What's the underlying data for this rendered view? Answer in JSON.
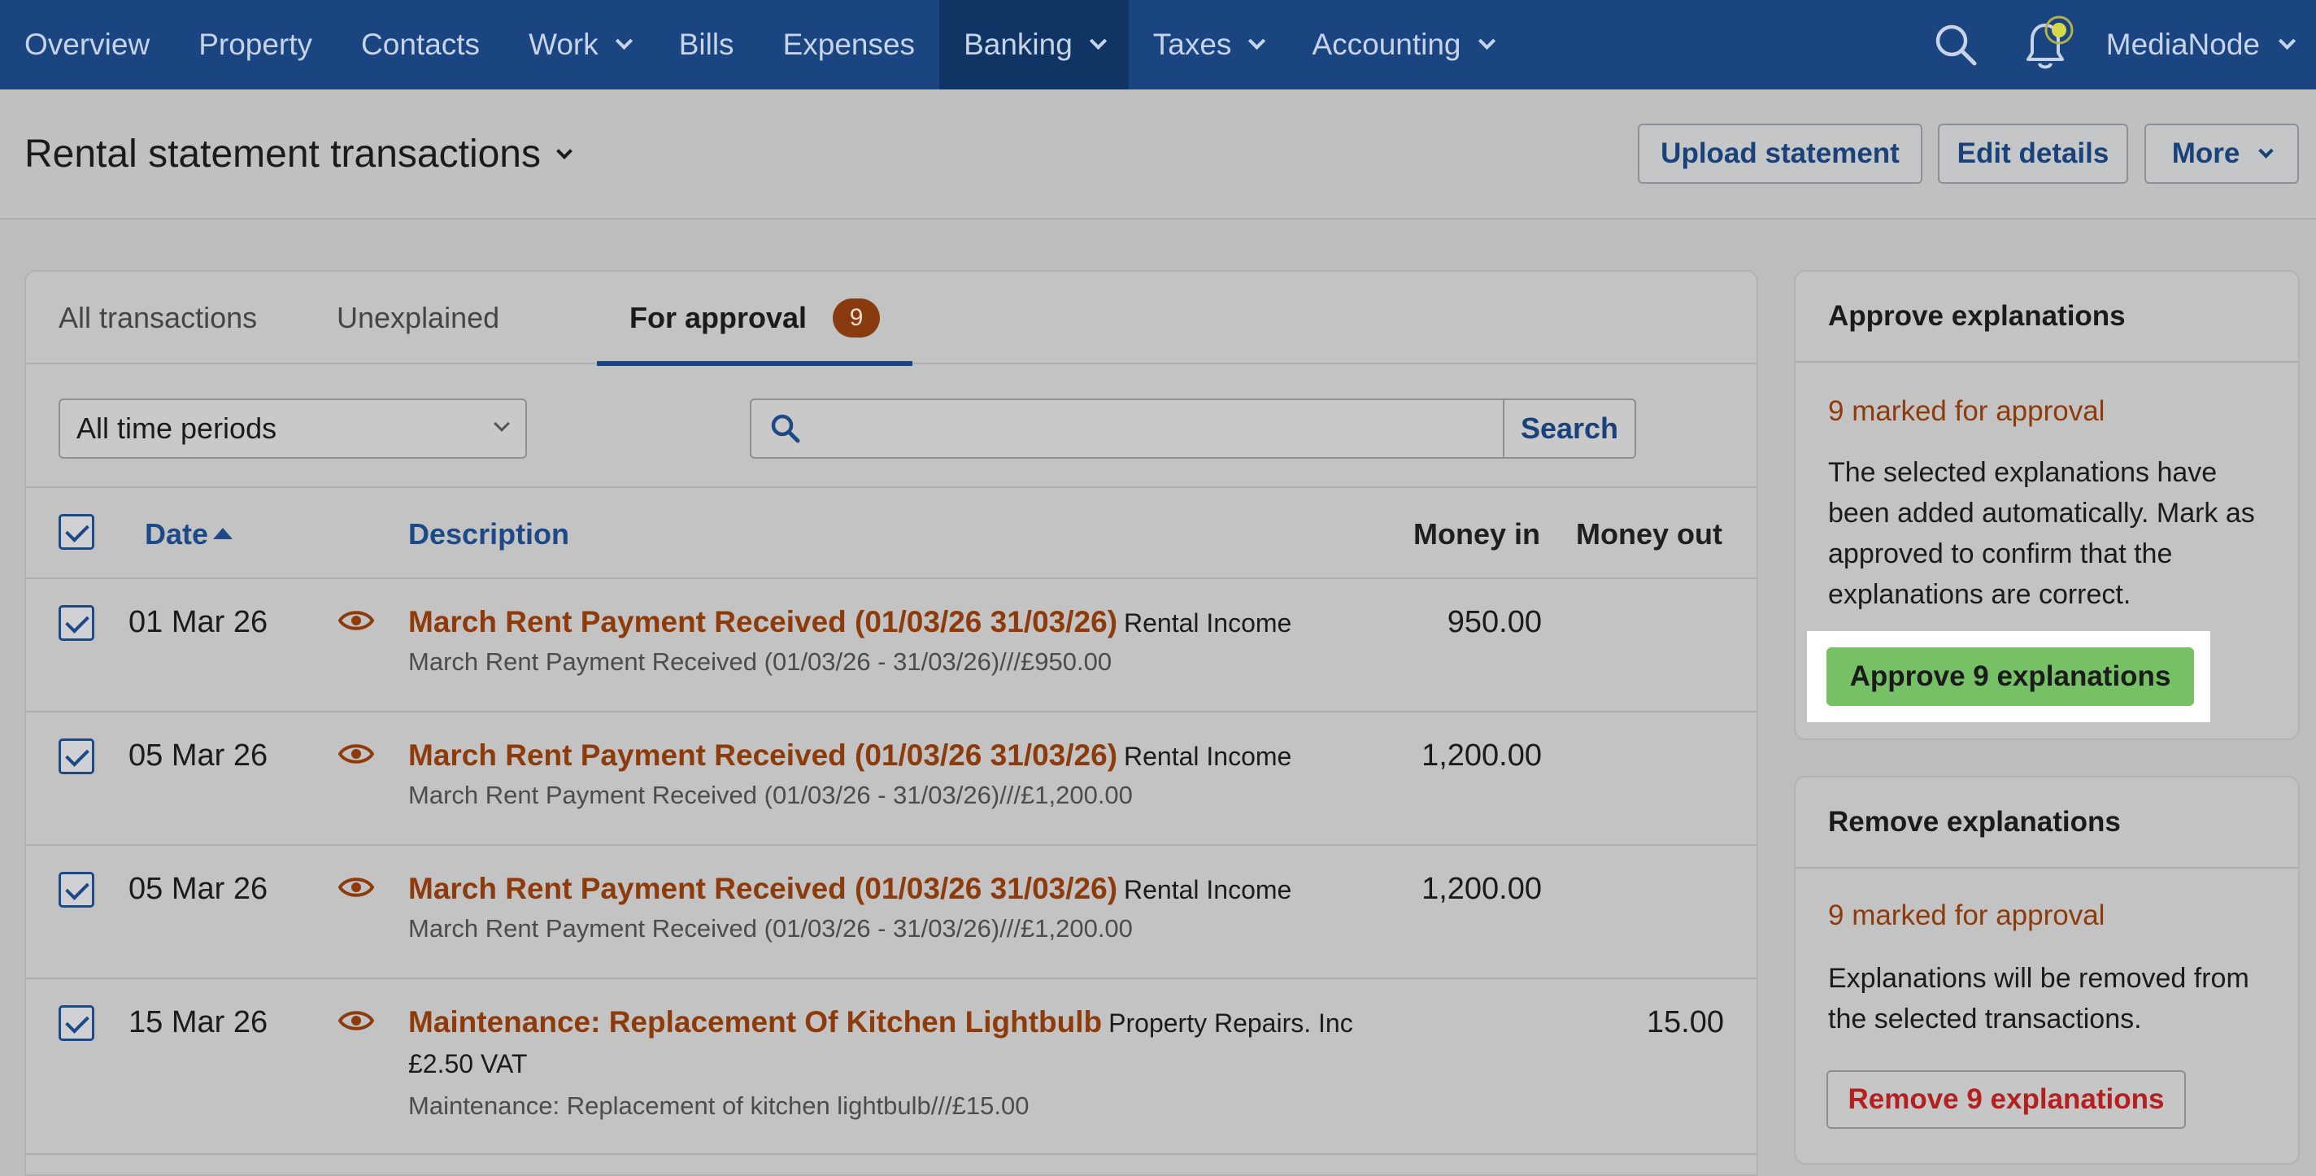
{
  "nav": {
    "items": [
      {
        "label": "Overview"
      },
      {
        "label": "Property"
      },
      {
        "label": "Contacts"
      },
      {
        "label": "Work"
      },
      {
        "label": "Bills"
      },
      {
        "label": "Expenses"
      },
      {
        "label": "Banking"
      },
      {
        "label": "Taxes"
      },
      {
        "label": "Accounting"
      }
    ],
    "account": "MediaNode"
  },
  "page": {
    "title": "Rental statement transactions",
    "upload_label": "Upload statement",
    "edit_label": "Edit details",
    "more_label": "More"
  },
  "tabs": {
    "all": "All transactions",
    "unexplained": "Unexplained",
    "approval": "For approval",
    "approval_count": "9"
  },
  "filters": {
    "period": "All time periods",
    "search_value": "",
    "search_label": "Search"
  },
  "table": {
    "headers": {
      "date": "Date",
      "description": "Description",
      "money_in": "Money in",
      "money_out": "Money out"
    },
    "rows": [
      {
        "date": "01 Mar 26",
        "title": "March Rent Payment Received (01/03/26 31/03/26)",
        "category": "Rental Income",
        "detail": "March Rent Payment Received (01/03/26 - 31/03/26)///£950.00",
        "money_in": "950.00",
        "money_out": ""
      },
      {
        "date": "05 Mar 26",
        "title": "March Rent Payment Received (01/03/26 31/03/26)",
        "category": "Rental Income",
        "detail": "March Rent Payment Received (01/03/26 - 31/03/26)///£1,200.00",
        "money_in": "1,200.00",
        "money_out": ""
      },
      {
        "date": "05 Mar 26",
        "title": "March Rent Payment Received (01/03/26 31/03/26)",
        "category": "Rental Income",
        "detail": "March Rent Payment Received (01/03/26 - 31/03/26)///£1,200.00",
        "money_in": "1,200.00",
        "money_out": ""
      },
      {
        "date": "15 Mar 26",
        "title": "Maintenance: Replacement Of Kitchen Lightbulb",
        "category": "Property Repairs. Inc",
        "vat": "£2.50 VAT",
        "detail": "Maintenance: Replacement of kitchen lightbulb///£15.00",
        "money_in": "",
        "money_out": "15.00"
      }
    ]
  },
  "approve_panel": {
    "title": "Approve explanations",
    "count_text": "9 marked for approval",
    "body": "The selected explanations have been added automatically. Mark as approved to confirm that the explanations are correct.",
    "button": "Approve 9 explanations"
  },
  "remove_panel": {
    "title": "Remove explanations",
    "count_text": "9 marked for approval",
    "body": "Explanations will be removed from the selected transactions.",
    "button": "Remove 9 explanations"
  },
  "colors": {
    "nav_bg": "#1a4581",
    "accent_link": "#1d4a86",
    "orange_text": "#8e3b0c",
    "approve_green": "#76c066",
    "remove_red": "#b3201f"
  },
  "icons": {
    "search": "search-icon",
    "notifications": "bell-icon",
    "row_view": "eye-icon"
  }
}
